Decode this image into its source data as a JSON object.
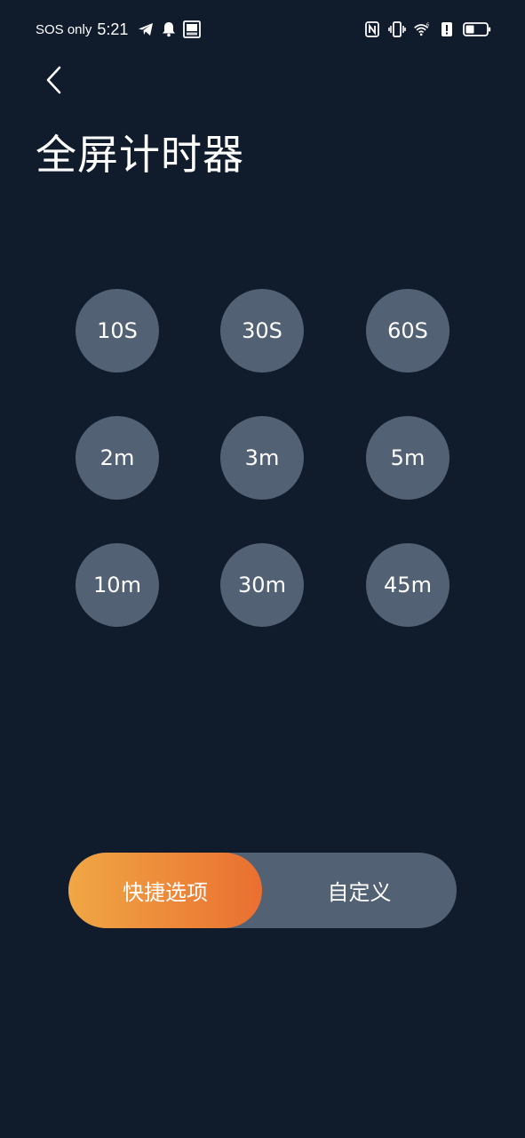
{
  "status_bar": {
    "carrier": "SOS only",
    "time": "5:21",
    "icons_left": [
      "telegram-icon",
      "bell-icon",
      "image-icon"
    ],
    "icons_right": [
      "nfc-icon",
      "vibrate-icon",
      "wifi-icon",
      "alert-icon",
      "battery-icon"
    ],
    "battery_level": 0.4
  },
  "header": {
    "back_icon": "chevron-left-icon",
    "title": "全屏计时器"
  },
  "presets": [
    [
      "10S",
      "30S",
      "60S"
    ],
    [
      "2m",
      "3m",
      "5m"
    ],
    [
      "10m",
      "30m",
      "45m"
    ]
  ],
  "mode_toggle": {
    "quick_label": "快捷选项",
    "custom_label": "自定义",
    "selected": "quick"
  },
  "colors": {
    "background": "#101b2c",
    "preset_fill": "#536174",
    "toggle_track": "#536174",
    "accent_gradient_start": "#f0a744",
    "accent_gradient_end": "#ea6f31"
  }
}
